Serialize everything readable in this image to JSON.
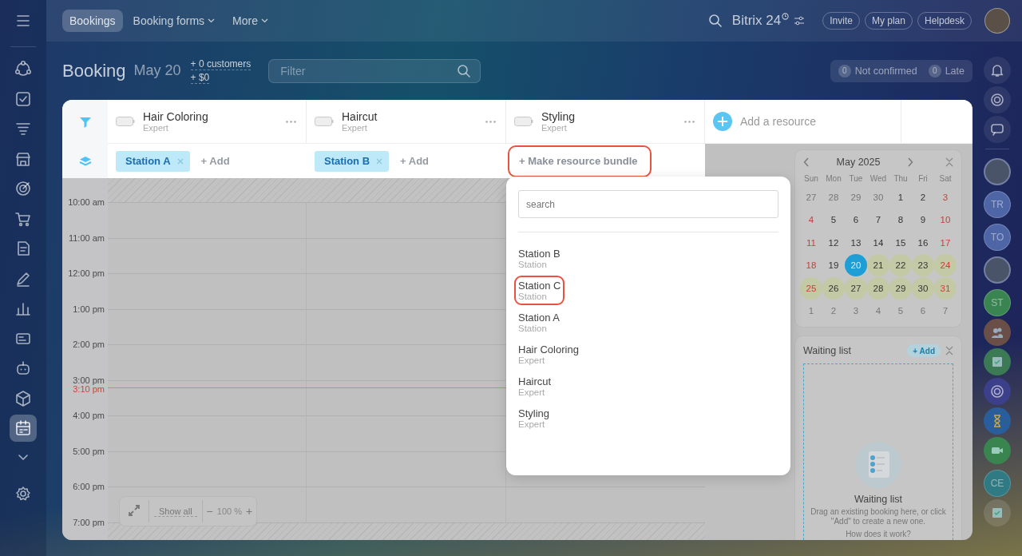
{
  "sidebar": {
    "items": [
      {
        "selected": false
      },
      {
        "selected": false
      },
      {
        "selected": false
      },
      {
        "selected": false
      },
      {
        "selected": false
      },
      {
        "selected": false
      },
      {
        "selected": false
      },
      {
        "selected": false
      },
      {
        "selected": false
      },
      {
        "selected": false
      },
      {
        "selected": false
      },
      {
        "selected": false
      },
      {
        "selected": true
      }
    ]
  },
  "top_bar": {
    "tabs": [
      {
        "label": "Bookings",
        "selected": true,
        "dropdown": false
      },
      {
        "label": "Booking forms",
        "selected": false,
        "dropdown": true
      },
      {
        "label": "More",
        "selected": false,
        "dropdown": true
      }
    ],
    "logo": "Bitrix 24",
    "buttons": [
      "Invite",
      "My plan",
      "Helpdesk"
    ]
  },
  "header": {
    "title": "Booking",
    "date": "May 20",
    "customers": "+ 0 customers",
    "revenue": "+ $0",
    "filter": {
      "placeholder": "Filter"
    },
    "counters": [
      {
        "count": "0",
        "label": "Not confirmed"
      },
      {
        "count": "0",
        "label": "Late"
      }
    ]
  },
  "resources": [
    {
      "name": "Hair Coloring",
      "type": "Expert",
      "kind": "chips",
      "bundle": [
        "Station A"
      ],
      "action": "+ Add",
      "highlighted": false
    },
    {
      "name": "Haircut",
      "type": "Expert",
      "kind": "chips",
      "bundle": [
        "Station B"
      ],
      "action": "+ Add",
      "highlighted": false
    },
    {
      "name": "Styling",
      "type": "Expert",
      "kind": "make_bundle",
      "action": "+ Make resource bundle",
      "highlighted": true
    }
  ],
  "add_resource": "Add a resource",
  "times": [
    "10:00 am",
    "11:00 am",
    "12:00 pm",
    "1:00 pm",
    "2:00 pm",
    "3:00 pm",
    "4:00 pm",
    "5:00 pm",
    "6:00 pm",
    "7:00 pm"
  ],
  "now_label": "3:10 pm",
  "zoom": {
    "show_all": "Show all",
    "minus": "−",
    "value": "100 %",
    "plus": "+"
  },
  "dropdown": {
    "search": {
      "placeholder": "search"
    },
    "options": [
      {
        "name": "Station B",
        "type": "Station",
        "highlighted": false
      },
      {
        "name": "Station C",
        "type": "Station",
        "highlighted": true
      },
      {
        "name": "Station A",
        "type": "Station",
        "highlighted": false
      },
      {
        "name": "Hair Coloring",
        "type": "Expert",
        "highlighted": false
      },
      {
        "name": "Haircut",
        "type": "Expert",
        "highlighted": false
      },
      {
        "name": "Styling",
        "type": "Expert",
        "highlighted": false
      }
    ]
  },
  "calendar": {
    "month": "May 2025",
    "weekdays": [
      "Sun",
      "Mon",
      "Tue",
      "Wed",
      "Thu",
      "Fri",
      "Sat"
    ],
    "days": [
      {
        "day": "27",
        "outside": true,
        "weekend": false,
        "selected": false,
        "marked": false
      },
      {
        "day": "28",
        "outside": true,
        "weekend": false,
        "selected": false,
        "marked": false
      },
      {
        "day": "29",
        "outside": true,
        "weekend": false,
        "selected": false,
        "marked": false
      },
      {
        "day": "30",
        "outside": true,
        "weekend": false,
        "selected": false,
        "marked": false
      },
      {
        "day": "1",
        "outside": false,
        "weekend": false,
        "selected": false,
        "marked": false
      },
      {
        "day": "2",
        "outside": false,
        "weekend": false,
        "selected": false,
        "marked": false
      },
      {
        "day": "3",
        "outside": false,
        "weekend": true,
        "selected": false,
        "marked": false
      },
      {
        "day": "4",
        "outside": false,
        "weekend": true,
        "selected": false,
        "marked": false
      },
      {
        "day": "5",
        "outside": false,
        "weekend": false,
        "selected": false,
        "marked": false
      },
      {
        "day": "6",
        "outside": false,
        "weekend": false,
        "selected": false,
        "marked": false
      },
      {
        "day": "7",
        "outside": false,
        "weekend": false,
        "selected": false,
        "marked": false
      },
      {
        "day": "8",
        "outside": false,
        "weekend": false,
        "selected": false,
        "marked": false
      },
      {
        "day": "9",
        "outside": false,
        "weekend": false,
        "selected": false,
        "marked": false
      },
      {
        "day": "10",
        "outside": false,
        "weekend": true,
        "selected": false,
        "marked": false
      },
      {
        "day": "11",
        "outside": false,
        "weekend": true,
        "selected": false,
        "marked": false
      },
      {
        "day": "12",
        "outside": false,
        "weekend": false,
        "selected": false,
        "marked": false
      },
      {
        "day": "13",
        "outside": false,
        "weekend": false,
        "selected": false,
        "marked": false
      },
      {
        "day": "14",
        "outside": false,
        "weekend": false,
        "selected": false,
        "marked": false
      },
      {
        "day": "15",
        "outside": false,
        "weekend": false,
        "selected": false,
        "marked": false
      },
      {
        "day": "16",
        "outside": false,
        "weekend": false,
        "selected": false,
        "marked": false
      },
      {
        "day": "17",
        "outside": false,
        "weekend": true,
        "selected": false,
        "marked": false
      },
      {
        "day": "18",
        "outside": false,
        "weekend": true,
        "selected": false,
        "marked": false
      },
      {
        "day": "19",
        "outside": false,
        "weekend": false,
        "selected": false,
        "marked": false
      },
      {
        "day": "20",
        "outside": false,
        "weekend": false,
        "selected": true,
        "marked": false
      },
      {
        "day": "21",
        "outside": false,
        "weekend": false,
        "selected": false,
        "marked": true
      },
      {
        "day": "22",
        "outside": false,
        "weekend": false,
        "selected": false,
        "marked": true
      },
      {
        "day": "23",
        "outside": false,
        "weekend": false,
        "selected": false,
        "marked": true
      },
      {
        "day": "24",
        "outside": false,
        "weekend": true,
        "selected": false,
        "marked": true
      },
      {
        "day": "25",
        "outside": false,
        "weekend": true,
        "selected": false,
        "marked": true
      },
      {
        "day": "26",
        "outside": false,
        "weekend": false,
        "selected": false,
        "marked": true
      },
      {
        "day": "27",
        "outside": false,
        "weekend": false,
        "selected": false,
        "marked": true
      },
      {
        "day": "28",
        "outside": false,
        "weekend": false,
        "selected": false,
        "marked": true
      },
      {
        "day": "29",
        "outside": false,
        "weekend": false,
        "selected": false,
        "marked": true
      },
      {
        "day": "30",
        "outside": false,
        "weekend": false,
        "selected": false,
        "marked": true
      },
      {
        "day": "31",
        "outside": false,
        "weekend": true,
        "selected": false,
        "marked": true
      },
      {
        "day": "1",
        "outside": true,
        "weekend": false,
        "selected": false,
        "marked": false
      },
      {
        "day": "2",
        "outside": true,
        "weekend": false,
        "selected": false,
        "marked": false
      },
      {
        "day": "3",
        "outside": true,
        "weekend": false,
        "selected": false,
        "marked": false
      },
      {
        "day": "4",
        "outside": true,
        "weekend": false,
        "selected": false,
        "marked": false
      },
      {
        "day": "5",
        "outside": true,
        "weekend": false,
        "selected": false,
        "marked": false
      },
      {
        "day": "6",
        "outside": true,
        "weekend": false,
        "selected": false,
        "marked": false
      },
      {
        "day": "7",
        "outside": true,
        "weekend": false,
        "selected": false,
        "marked": false
      }
    ]
  },
  "waiting_list": {
    "title": "Waiting list",
    "add": "+ Add",
    "empty_title": "Waiting list",
    "empty_text": "Drag an existing booking here, or click \"Add\" to create a new one.",
    "help_link": "How does it work?"
  },
  "right_rail": {
    "contacts": [
      {
        "initials": "TR",
        "color": "#4f66a6"
      },
      {
        "initials": "TO",
        "color": "#4f66a6"
      },
      {
        "initials": "ST",
        "color": "#3a8452"
      },
      {
        "initials": "CE",
        "color": "#2f7a83"
      }
    ]
  }
}
